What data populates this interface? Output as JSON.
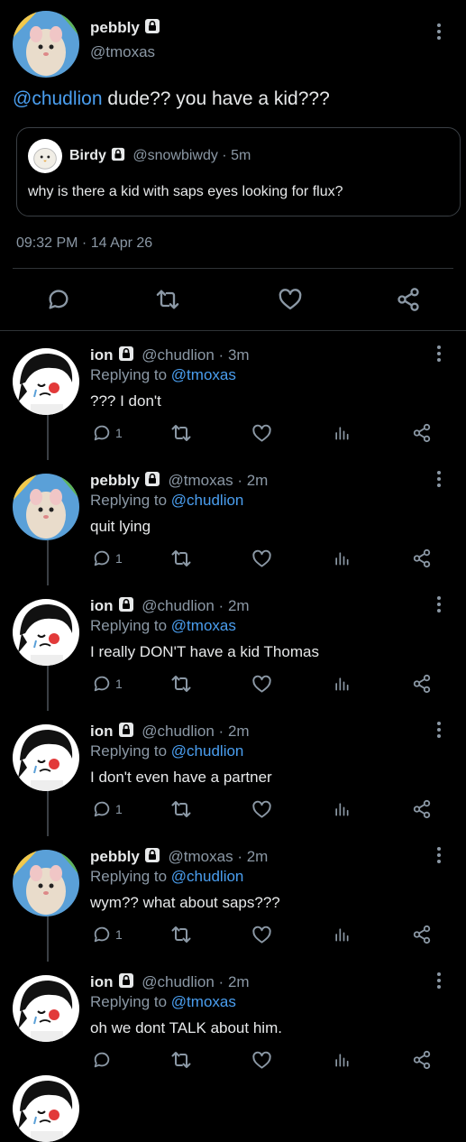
{
  "main_tweet": {
    "name": "pebbly",
    "handle": "@tmoxas",
    "mention": "@chudlion",
    "text": " dude?? you have a kid???",
    "quote": {
      "name": "Birdy",
      "handle": "@snowbiwdy",
      "time": "5m",
      "text": "why is there a kid with saps eyes looking for flux?"
    },
    "timestamp": "09:32 PM · 14 Apr 26"
  },
  "replies": [
    {
      "name": "ion",
      "handle": "@chudlion",
      "time": "3m",
      "replying_label": "Replying to",
      "replying_to": "@tmoxas",
      "text": "??? I don't",
      "reply_count": "1",
      "avatar": "ion"
    },
    {
      "name": "pebbly",
      "handle": "@tmoxas",
      "time": "2m",
      "replying_label": "Replying to",
      "replying_to": "@chudlion",
      "text": "quit lying",
      "reply_count": "1",
      "avatar": "pebbly"
    },
    {
      "name": "ion",
      "handle": "@chudlion",
      "time": "2m",
      "replying_label": "Replying to",
      "replying_to": "@tmoxas",
      "text": "I really DON'T have a kid Thomas",
      "reply_count": "1",
      "avatar": "ion"
    },
    {
      "name": "ion",
      "handle": "@chudlion",
      "time": "2m",
      "replying_label": "Replying to",
      "replying_to": "@chudlion",
      "text": "I don't even have a partner",
      "reply_count": "1",
      "avatar": "ion"
    },
    {
      "name": "pebbly",
      "handle": "@tmoxas",
      "time": "2m",
      "replying_label": "Replying to",
      "replying_to": "@chudlion",
      "text": "wym?? what about saps???",
      "reply_count": "1",
      "avatar": "pebbly"
    },
    {
      "name": "ion",
      "handle": "@chudlion",
      "time": "2m",
      "replying_label": "Replying to",
      "replying_to": "@tmoxas",
      "text": "oh we dont TALK about him.",
      "reply_count": "",
      "avatar": "ion"
    }
  ],
  "icons": {
    "reply": "reply-icon",
    "retweet": "retweet-icon",
    "like": "heart-icon",
    "views": "views-icon",
    "share": "share-icon",
    "lock": "lock-icon",
    "more": "more-icon"
  },
  "colors": {
    "background": "#000000",
    "text": "#e7e9ea",
    "secondary": "#8b98a5",
    "link": "#4a9eef"
  }
}
